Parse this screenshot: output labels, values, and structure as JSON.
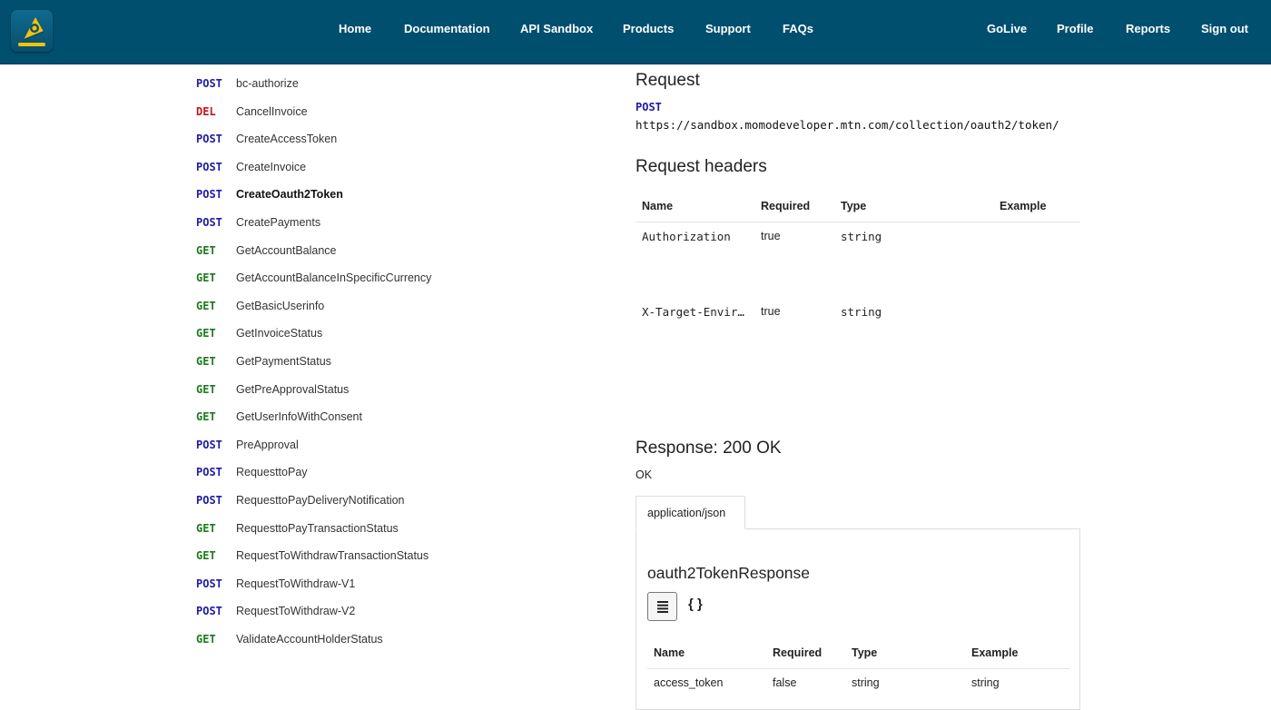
{
  "header": {
    "logo": "developer-portal-logo-icon",
    "nav_primary": [
      "Home",
      "Documentation",
      "API Sandbox",
      "Products",
      "Support",
      "FAQs"
    ],
    "nav_secondary": [
      "GoLive",
      "Profile",
      "Reports",
      "Sign out"
    ]
  },
  "operations": [
    {
      "method": "POST",
      "name": "bc-authorize"
    },
    {
      "method": "DEL",
      "name": "CancelInvoice"
    },
    {
      "method": "POST",
      "name": "CreateAccessToken"
    },
    {
      "method": "POST",
      "name": "CreateInvoice"
    },
    {
      "method": "POST",
      "name": "CreateOauth2Token",
      "active": true
    },
    {
      "method": "POST",
      "name": "CreatePayments"
    },
    {
      "method": "GET",
      "name": "GetAccountBalance"
    },
    {
      "method": "GET",
      "name": "GetAccountBalanceInSpecificCurrency"
    },
    {
      "method": "GET",
      "name": "GetBasicUserinfo"
    },
    {
      "method": "GET",
      "name": "GetInvoiceStatus"
    },
    {
      "method": "GET",
      "name": "GetPaymentStatus"
    },
    {
      "method": "GET",
      "name": "GetPreApprovalStatus"
    },
    {
      "method": "GET",
      "name": "GetUserInfoWithConsent"
    },
    {
      "method": "POST",
      "name": "PreApproval"
    },
    {
      "method": "POST",
      "name": "RequesttoPay"
    },
    {
      "method": "POST",
      "name": "RequesttoPayDeliveryNotification"
    },
    {
      "method": "GET",
      "name": "RequesttoPayTransactionStatus"
    },
    {
      "method": "GET",
      "name": "RequestToWithdrawTransactionStatus"
    },
    {
      "method": "POST",
      "name": "RequestToWithdraw-V1"
    },
    {
      "method": "POST",
      "name": "RequestToWithdraw-V2"
    },
    {
      "method": "GET",
      "name": "ValidateAccountHolderStatus"
    }
  ],
  "method_colors": {
    "POST": "#1f1aa8",
    "GET": "#1d7a1d",
    "DEL": "#c0161d"
  },
  "request": {
    "title": "Request",
    "method": "POST",
    "url": "https://sandbox.momodeveloper.mtn.com/collection/oauth2/token/"
  },
  "request_headers": {
    "title": "Request headers",
    "columns": [
      "Name",
      "Required",
      "Type",
      "Example"
    ],
    "rows": [
      {
        "name": "Authorization",
        "required": "true",
        "type": "string",
        "example": ""
      },
      {
        "name": "X-Target-Envir…",
        "required": "true",
        "type": "string",
        "example": ""
      }
    ]
  },
  "response": {
    "title": "Response: 200 OK",
    "status_text": "OK",
    "tab_label": "application/json",
    "schema_title": "oauth2TokenResponse",
    "view_toggle_icons": [
      "table-view-icon",
      "json-braces-icon"
    ],
    "json_label": "{ }",
    "columns": [
      "Name",
      "Required",
      "Type",
      "Example"
    ],
    "rows": [
      {
        "name": "access_token",
        "required": "false",
        "type": "string",
        "example": "string"
      }
    ]
  }
}
